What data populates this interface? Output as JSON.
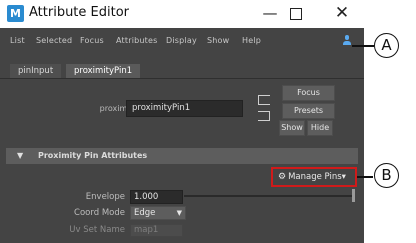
{
  "window": {
    "app_icon_letter": "M",
    "title": "Attribute Editor",
    "minimize": "—",
    "close": "✕"
  },
  "menubar": {
    "items": [
      "List",
      "Selected",
      "Focus",
      "Attributes",
      "Display",
      "Show",
      "Help"
    ]
  },
  "tabs": [
    {
      "label": "pinInput",
      "active": false
    },
    {
      "label": "proximityPin1",
      "active": true
    }
  ],
  "node": {
    "label": "proximityPin:",
    "value": "proximityPin1"
  },
  "side_buttons": {
    "focus": "Focus",
    "presets": "Presets",
    "show": "Show",
    "hide": "Hide"
  },
  "section": {
    "arrow": "▼",
    "title": "Proximity Pin Attributes"
  },
  "manage_pins": {
    "gear": "⚙",
    "label": "Manage Pins",
    "chevron": "▾"
  },
  "attributes": {
    "envelope": {
      "label": "Envelope",
      "value": "1.000",
      "slider_fraction": 1.0
    },
    "coord_mode": {
      "label": "Coord Mode",
      "value": "Edge",
      "chevron": "▼"
    },
    "uv_set_name": {
      "label": "Uv Set Name",
      "value": "map1"
    }
  },
  "callouts": {
    "a": "A",
    "b": "B"
  },
  "colors": {
    "panel_bg": "#444444",
    "highlight_box": "#d01a1a",
    "user_icon": "#5aaaf0",
    "app_icon": "#2a8bd0"
  }
}
